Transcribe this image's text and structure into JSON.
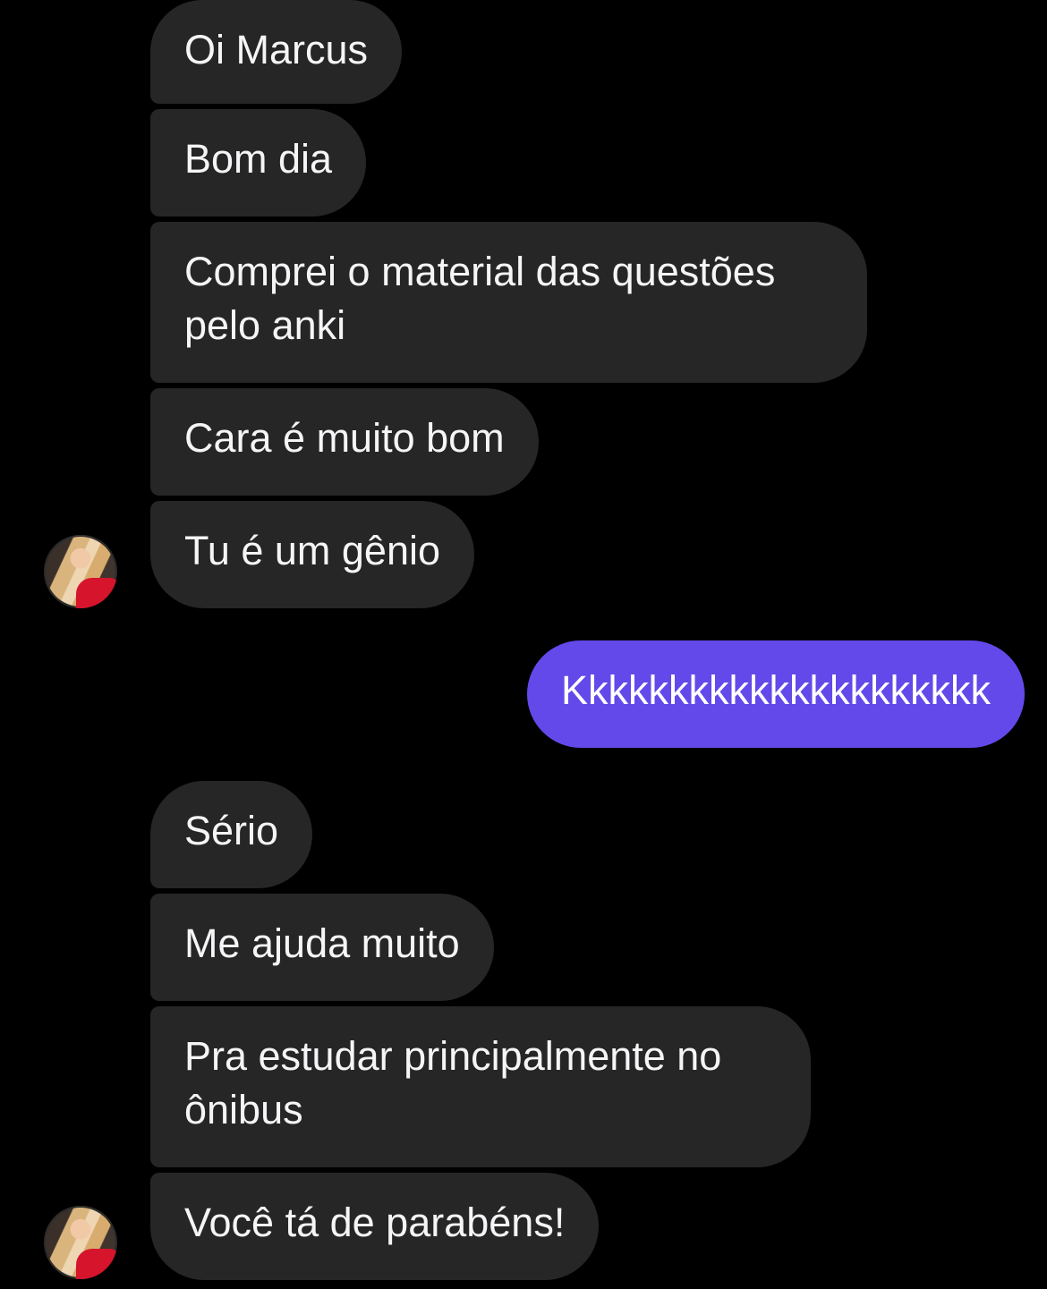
{
  "conversation": {
    "messages": [
      {
        "sender": "other",
        "text": "Oi Marcus"
      },
      {
        "sender": "other",
        "text": "Bom dia"
      },
      {
        "sender": "other",
        "text": "Comprei o material das questões pelo anki"
      },
      {
        "sender": "other",
        "text": "Cara é muito bom"
      },
      {
        "sender": "other",
        "text": "Tu é um gênio"
      },
      {
        "sender": "me",
        "text": "Kkkkkkkkkkkkkkkkkkkkk"
      },
      {
        "sender": "other",
        "text": "Sério"
      },
      {
        "sender": "other",
        "text": "Me ajuda muito"
      },
      {
        "sender": "other",
        "text": "Pra estudar principalmente no ônibus"
      },
      {
        "sender": "other",
        "text": "Você tá de parabéns!"
      }
    ]
  },
  "contact": {
    "avatar_icon": "profile-photo-avatar"
  },
  "colors": {
    "background": "#000000",
    "incoming_bubble": "#262626",
    "outgoing_bubble": "#6349ea",
    "text": "#f5f5f7"
  }
}
